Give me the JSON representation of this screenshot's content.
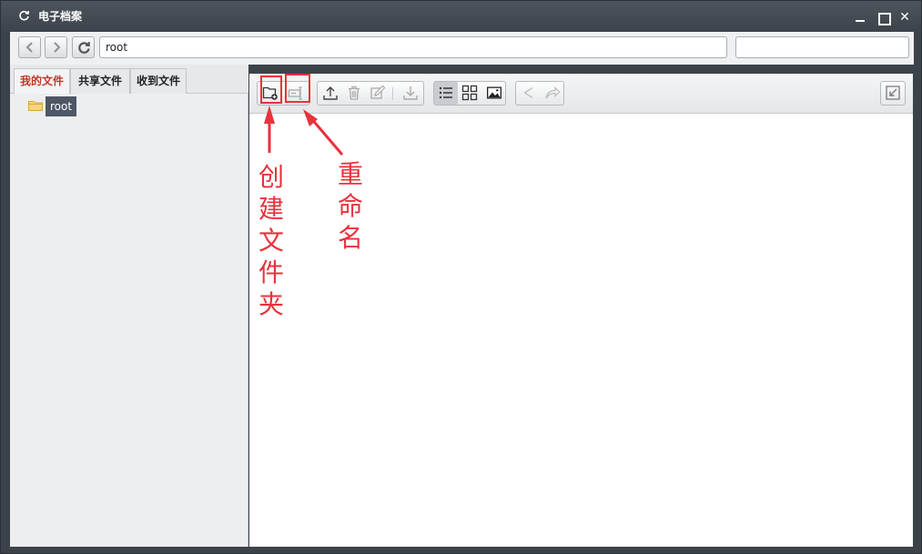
{
  "window": {
    "title": "电子档案",
    "minimize_icon": "minimize-icon",
    "maximize_icon": "maximize-icon",
    "close_label": "✕"
  },
  "nav": {
    "address_value": "root",
    "search_value": "",
    "search_placeholder": ""
  },
  "sidebar": {
    "tabs": [
      {
        "label": "我的文件",
        "active": true
      },
      {
        "label": "共享文件",
        "active": false
      },
      {
        "label": "收到文件",
        "active": false
      }
    ],
    "tree": [
      {
        "label": "root",
        "icon": "folder-icon",
        "selected": true
      }
    ]
  },
  "toolbar": {
    "buttons": [
      "new-folder-icon",
      "rename-icon",
      "upload-icon",
      "delete-icon",
      "edit-icon",
      "download-icon",
      "list-view-icon",
      "grid-view-icon",
      "image-view-icon",
      "share-icon",
      "forward-icon",
      "collapse-icon"
    ],
    "active_view": "list"
  },
  "annotations": {
    "create_folder": "创建文件夹",
    "rename": "重命名",
    "color": "#e8323c"
  },
  "colors": {
    "titlebar": "#444b52",
    "selected_item": "#4d5766",
    "active_tab": "#c0392b"
  }
}
